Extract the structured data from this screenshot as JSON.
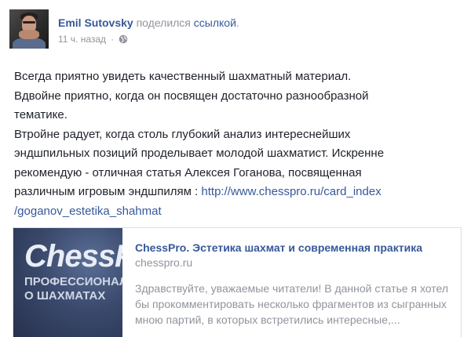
{
  "post": {
    "author": "Emil Sutovsky",
    "action_text": "поделился",
    "action_link": "ссылкой",
    "action_end": ".",
    "timestamp": "11 ч. назад",
    "dot": "·",
    "privacy_icon": "globe-icon",
    "body": {
      "line1": "Всегда приятно увидеть качественный шахматный материал.",
      "line2": "Вдвойне приятно, когда он посвящен достаточно разнообразной",
      "line3": "тематике.",
      "line4": "Втройне радует, когда столь глубокий анализ интереснейших",
      "line5": "эндшпильных позиций проделывает молодой шахматист. Искренне",
      "line6": "рекомендую - отличная статья Алексея Гоганова, посвященная",
      "line7_prefix": "различным игровым эндшпилям : ",
      "line7_link": "http://www.chesspro.ru/card_index",
      "line8_link": "/goganov_estetika_shahmat"
    }
  },
  "card": {
    "image": {
      "logo_text": "ChessPro",
      "subtitle_line1": "ПРОФЕССИОНАЛЬНО",
      "subtitle_line2": "О ШАХМАТАХ"
    },
    "title": "ChessPro. Эстетика шахмат и современная практика",
    "domain": "chesspro.ru",
    "description": "Здравствуйте, уважаемые читатели! В данной статье я хотел бы прокомментировать несколько фрагментов из сыгранных мною партий, в которых встретились интересные,..."
  },
  "colors": {
    "link": "#365899",
    "meta_gray": "#90949c",
    "text": "#1d2129"
  }
}
